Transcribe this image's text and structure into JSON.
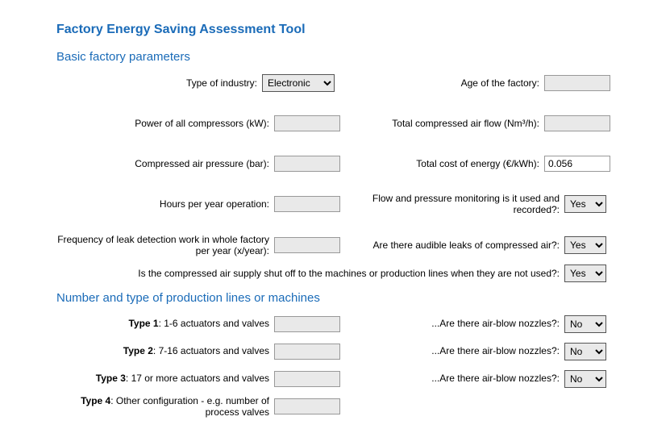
{
  "title": "Factory Energy Saving Assessment Tool",
  "section_basic": "Basic factory parameters",
  "section_prod": "Number and type of production lines or machines",
  "labels": {
    "type_industry": "Type of industry:",
    "age_factory": "Age of the factory:",
    "power_compressors": "Power of all compressors (kW):",
    "total_air_flow": "Total compressed air flow (Nm³/h):",
    "air_pressure": "Compressed air pressure (bar):",
    "cost_energy": "Total cost of energy (€/kWh):",
    "hours_year": "Hours per year operation:",
    "flow_monitoring": "Flow and pressure monitoring is it used and recorded?:",
    "leak_freq": "Frequency of leak detection work in whole factory per year (x/year):",
    "audible_leaks": "Are there audible leaks of compressed air?:",
    "shutoff": "Is the compressed air supply shut off to the machines or production lines when they are not used?:",
    "airblow": "...Are there air-blow nozzles?:"
  },
  "types": {
    "t1_b": "Type 1",
    "t1": ": 1-6 actuators and valves",
    "t2_b": "Type 2",
    "t2": ": 7-16 actuators and valves",
    "t3_b": "Type 3",
    "t3": ": 17 or more actuators and valves",
    "t4_b": "Type 4",
    "t4": ": Other configuration - e.g. number of process valves"
  },
  "values": {
    "industry_selected": "Electronic",
    "cost_energy": "0.056",
    "flow_monitoring": "Yes",
    "audible_leaks": "Yes",
    "shutoff": "Yes",
    "airblow1": "No",
    "airblow2": "No",
    "airblow3": "No"
  },
  "options": {
    "yes": "Yes",
    "no": "No"
  }
}
